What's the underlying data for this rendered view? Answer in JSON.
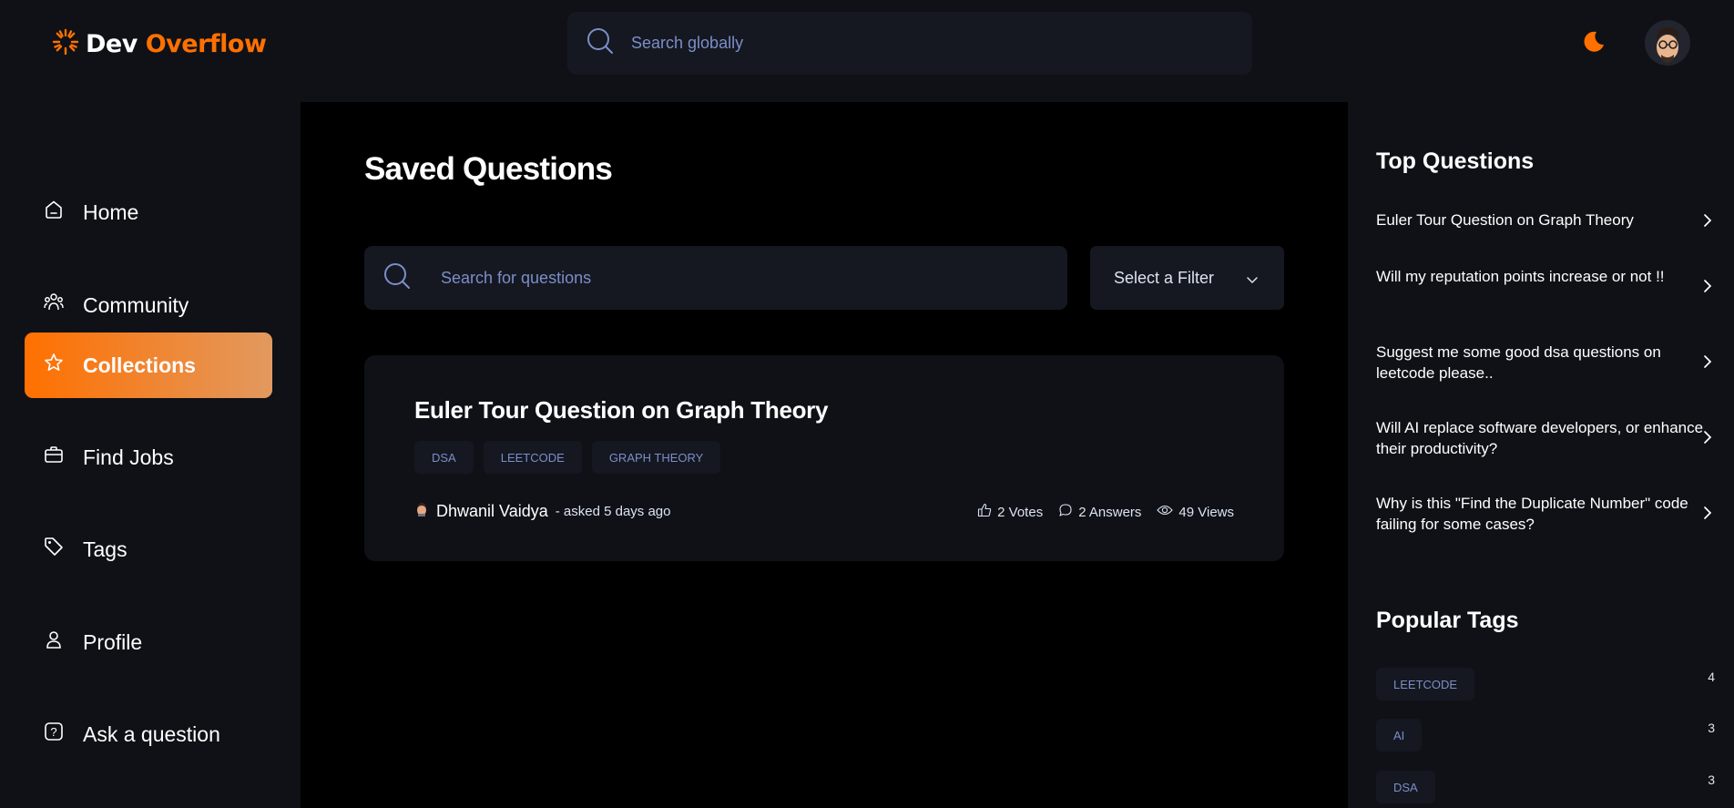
{
  "brand": {
    "part1": "Dev",
    "part2": "Overflow",
    "accent": "#ff7000"
  },
  "header": {
    "search_placeholder": "Search globally",
    "theme_icon": "moon-icon",
    "avatar_icon": "user-avatar"
  },
  "sidebar": {
    "items": [
      {
        "label": "Home",
        "icon": "home-icon",
        "active": false
      },
      {
        "label": "Community",
        "icon": "users-icon",
        "active": false
      },
      {
        "label": "Collections",
        "icon": "star-icon",
        "active": true
      },
      {
        "label": "Find Jobs",
        "icon": "briefcase-icon",
        "active": false
      },
      {
        "label": "Tags",
        "icon": "tag-icon",
        "active": false
      },
      {
        "label": "Profile",
        "icon": "user-icon",
        "active": false
      },
      {
        "label": "Ask a question",
        "icon": "question-icon",
        "active": false
      }
    ]
  },
  "main": {
    "title": "Saved Questions",
    "search_placeholder": "Search for questions",
    "filter_label": "Select a Filter",
    "questions": [
      {
        "title": "Euler Tour Question on Graph Theory",
        "tags": [
          "DSA",
          "LEETCODE",
          "GRAPH THEORY"
        ],
        "author": "Dhwanil Vaidya",
        "asked": "- asked 5 days ago",
        "votes": "2 Votes",
        "answers": "2 Answers",
        "views": "49 Views"
      }
    ]
  },
  "rightbar": {
    "top_questions_title": "Top Questions",
    "top_questions": [
      "Euler Tour Question on Graph Theory",
      "Will my reputation points increase or not !!",
      "Suggest me some good dsa questions on leetcode please..",
      "Will AI replace software developers, or enhance their productivity?",
      "Why is this \"Find the Duplicate Number\" code failing for some cases?"
    ],
    "popular_tags_title": "Popular Tags",
    "popular_tags": [
      {
        "name": "LEETCODE",
        "count": "4"
      },
      {
        "name": "AI",
        "count": "3"
      },
      {
        "name": "DSA",
        "count": "3"
      }
    ]
  }
}
